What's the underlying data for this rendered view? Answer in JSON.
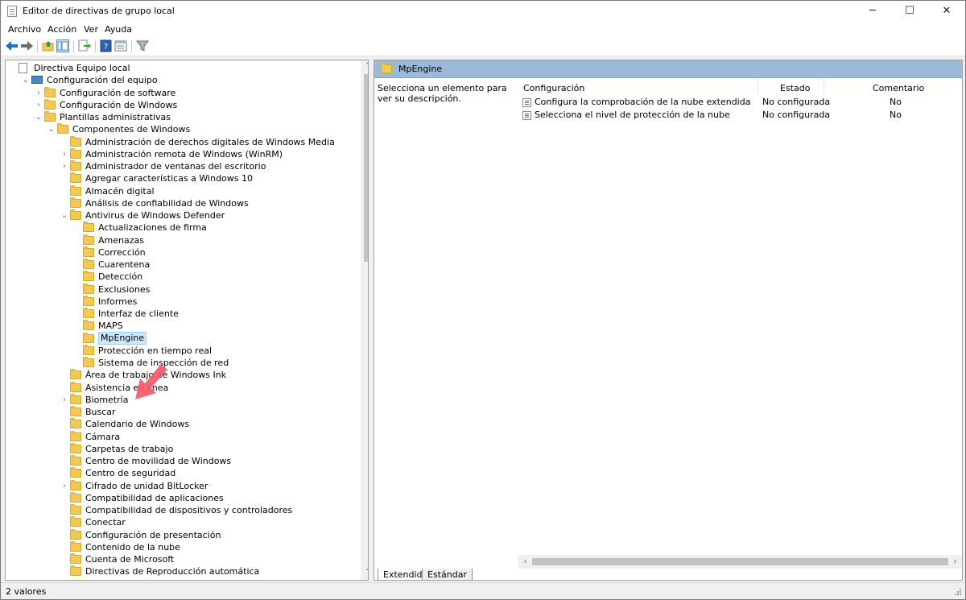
{
  "window": {
    "title": "Editor de directivas de grupo local",
    "min_glyph": "─",
    "max_glyph": "☐",
    "close_glyph": "✕"
  },
  "menu": {
    "items": [
      "Archivo",
      "Acción",
      "Ver",
      "Ayuda"
    ]
  },
  "toolbar": {
    "icons": [
      "back-arrow-icon",
      "forward-arrow-icon",
      "up-folder-icon",
      "show-hide-tree-icon",
      "export-list-icon",
      "help-icon",
      "properties-icon",
      "filter-icon"
    ]
  },
  "tree": {
    "items": [
      {
        "label": "Directiva Equipo local",
        "level": 0,
        "expander": "",
        "icon": "doc"
      },
      {
        "label": "Configuración del equipo",
        "level": 1,
        "expander": "⌄",
        "icon": "pc"
      },
      {
        "label": "Configuración de software",
        "level": 2,
        "expander": "›",
        "icon": "folder"
      },
      {
        "label": "Configuración de Windows",
        "level": 2,
        "expander": "›",
        "icon": "folder"
      },
      {
        "label": "Plantillas administrativas",
        "level": 2,
        "expander": "⌄",
        "icon": "folder"
      },
      {
        "label": "Componentes de Windows",
        "level": 3,
        "expander": "⌄",
        "icon": "folder"
      },
      {
        "label": "Administración de derechos digitales de Windows Media",
        "level": 4,
        "expander": "",
        "icon": "folder"
      },
      {
        "label": "Administración remota de Windows (WinRM)",
        "level": 4,
        "expander": "›",
        "icon": "folder"
      },
      {
        "label": "Administrador de ventanas del escritorio",
        "level": 4,
        "expander": "›",
        "icon": "folder"
      },
      {
        "label": "Agregar características a Windows 10",
        "level": 4,
        "expander": "",
        "icon": "folder"
      },
      {
        "label": "Almacén digital",
        "level": 4,
        "expander": "",
        "icon": "folder"
      },
      {
        "label": "Análisis de confiabilidad de Windows",
        "level": 4,
        "expander": "",
        "icon": "folder"
      },
      {
        "label": "Antivirus de Windows Defender",
        "level": 4,
        "expander": "⌄",
        "icon": "folder"
      },
      {
        "label": "Actualizaciones de firma",
        "level": 5,
        "expander": "",
        "icon": "folder"
      },
      {
        "label": "Amenazas",
        "level": 5,
        "expander": "",
        "icon": "folder"
      },
      {
        "label": "Corrección",
        "level": 5,
        "expander": "",
        "icon": "folder"
      },
      {
        "label": "Cuarentena",
        "level": 5,
        "expander": "",
        "icon": "folder"
      },
      {
        "label": "Detección",
        "level": 5,
        "expander": "",
        "icon": "folder"
      },
      {
        "label": "Exclusiones",
        "level": 5,
        "expander": "",
        "icon": "folder"
      },
      {
        "label": "Informes",
        "level": 5,
        "expander": "",
        "icon": "folder"
      },
      {
        "label": "Interfaz de cliente",
        "level": 5,
        "expander": "",
        "icon": "folder"
      },
      {
        "label": "MAPS",
        "level": 5,
        "expander": "",
        "icon": "folder"
      },
      {
        "label": "MpEngine",
        "level": 5,
        "expander": "",
        "icon": "folder",
        "selected": true
      },
      {
        "label": "Protección en tiempo real",
        "level": 5,
        "expander": "",
        "icon": "folder"
      },
      {
        "label": "Sistema de inspección de red",
        "level": 5,
        "expander": "",
        "icon": "folder"
      },
      {
        "label": "Área de trabajo de Windows Ink",
        "level": 4,
        "expander": "",
        "icon": "folder"
      },
      {
        "label": "Asistencia en línea",
        "level": 4,
        "expander": "",
        "icon": "folder"
      },
      {
        "label": "Biometría",
        "level": 4,
        "expander": "›",
        "icon": "folder"
      },
      {
        "label": "Buscar",
        "level": 4,
        "expander": "",
        "icon": "folder"
      },
      {
        "label": "Calendario de Windows",
        "level": 4,
        "expander": "",
        "icon": "folder"
      },
      {
        "label": "Cámara",
        "level": 4,
        "expander": "",
        "icon": "folder"
      },
      {
        "label": "Carpetas de trabajo",
        "level": 4,
        "expander": "",
        "icon": "folder"
      },
      {
        "label": "Centro de movilidad de Windows",
        "level": 4,
        "expander": "",
        "icon": "folder"
      },
      {
        "label": "Centro de seguridad",
        "level": 4,
        "expander": "",
        "icon": "folder"
      },
      {
        "label": "Cifrado de unidad BitLocker",
        "level": 4,
        "expander": "›",
        "icon": "folder"
      },
      {
        "label": "Compatibilidad de aplicaciones",
        "level": 4,
        "expander": "",
        "icon": "folder"
      },
      {
        "label": "Compatibilidad de dispositivos y controladores",
        "level": 4,
        "expander": "",
        "icon": "folder"
      },
      {
        "label": "Conectar",
        "level": 4,
        "expander": "",
        "icon": "folder"
      },
      {
        "label": "Configuración de presentación",
        "level": 4,
        "expander": "",
        "icon": "folder"
      },
      {
        "label": "Contenido de la nube",
        "level": 4,
        "expander": "",
        "icon": "folder"
      },
      {
        "label": "Cuenta de Microsoft",
        "level": 4,
        "expander": "",
        "icon": "folder"
      },
      {
        "label": "Directivas de Reproducción automática",
        "level": 4,
        "expander": "",
        "icon": "folder"
      }
    ],
    "scroll_up": "˄",
    "scroll_down": "˅"
  },
  "details": {
    "header_title": "MpEngine",
    "description": "Selecciona un elemento para ver su descripción.",
    "columns": {
      "config": "Configuración",
      "state": "Estado",
      "comment": "Comentario"
    },
    "rows": [
      {
        "name": "Configura la comprobación de la nube extendida",
        "state": "No configurada",
        "comment": "No"
      },
      {
        "name": "Selecciona el nivel de protección de la nube",
        "state": "No configurada",
        "comment": "No"
      }
    ],
    "hscroll_left": "‹",
    "hscroll_right": "›",
    "tabs": [
      "Extendido",
      "Estándar"
    ]
  },
  "status": {
    "text": "2 valores"
  }
}
